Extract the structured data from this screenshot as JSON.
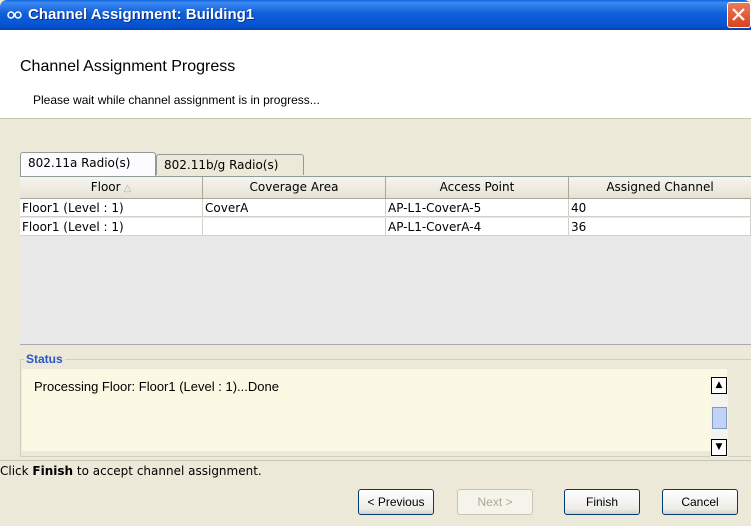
{
  "window": {
    "title": "Channel Assignment: Building1",
    "icon": "app-icon"
  },
  "header": {
    "title": "Channel Assignment Progress",
    "subtitle": "Please wait while channel assignment is in progress..."
  },
  "tabs": [
    {
      "label": "802.11a Radio(s)",
      "active": true
    },
    {
      "label": "802.11b/g Radio(s)",
      "active": false
    }
  ],
  "table": {
    "columns": [
      "Floor",
      "Coverage Area",
      "Access Point",
      "Assigned Channel"
    ],
    "rows": [
      [
        "Floor1 (Level : 1)",
        "CoverA",
        "AP-L1-CoverA-5",
        "40"
      ],
      [
        "Floor1 (Level : 1)",
        "",
        "AP-L1-CoverA-4",
        "36"
      ]
    ]
  },
  "status": {
    "legend": "Status",
    "lines": [
      "Processing Floor: Floor1 (Level : 1)...Done"
    ]
  },
  "hint": {
    "prefix": "Click ",
    "bold": "Finish",
    "suffix": " to accept channel assignment."
  },
  "buttons": {
    "previous": "< Previous",
    "next": "Next >",
    "finish": "Finish",
    "cancel": "Cancel"
  },
  "colors": {
    "titlebar": "#0653d2",
    "status_legend": "#2a56c6",
    "status_background": "#fbf9e3"
  }
}
